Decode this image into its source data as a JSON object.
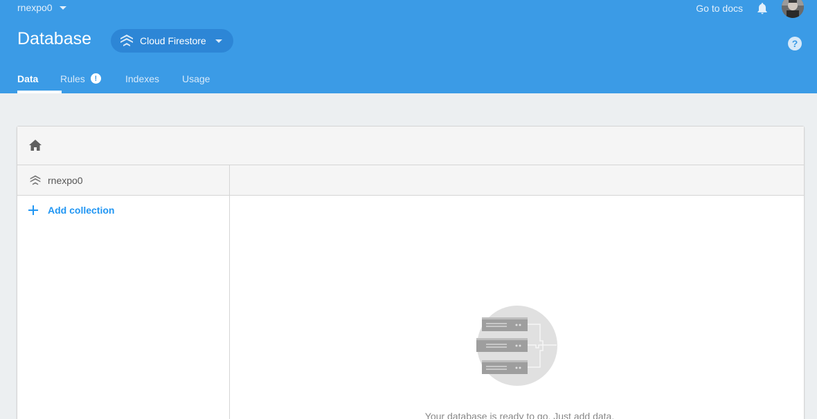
{
  "header": {
    "project_name": "rnexpo0",
    "docs_link": "Go to docs",
    "title": "Database",
    "product_select": "Cloud Firestore",
    "help_symbol": "?",
    "colors": {
      "header_bg": "#3b9be6",
      "select_bg": "#2d86d6",
      "accent": "#2196f3"
    }
  },
  "tabs": [
    {
      "label": "Data",
      "active": true
    },
    {
      "label": "Rules",
      "badge": "!"
    },
    {
      "label": "Indexes"
    },
    {
      "label": "Usage"
    }
  ],
  "panel": {
    "home_icon": "home-icon",
    "root_label": "rnexpo0",
    "add_collection": "Add collection",
    "empty_message": "Your database is ready to go. Just add data."
  }
}
